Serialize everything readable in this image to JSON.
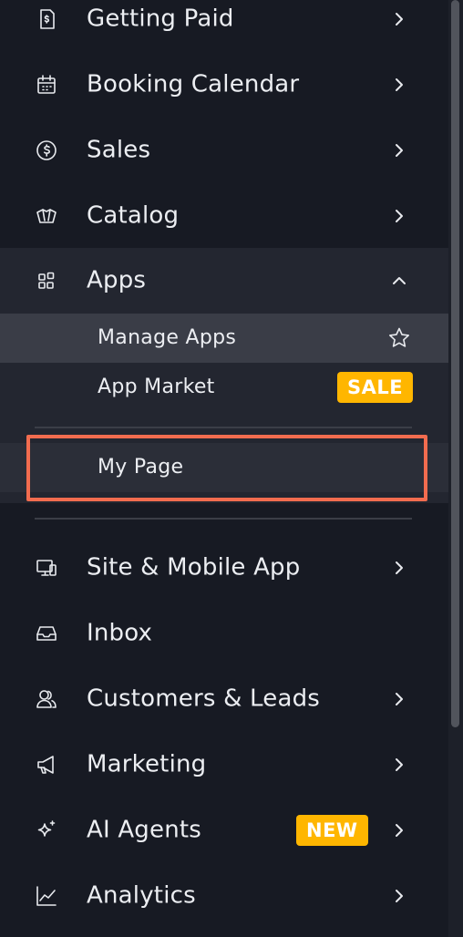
{
  "nav": {
    "getting_paid": {
      "label": "Getting Paid",
      "icon": "receipt-dollar-icon"
    },
    "booking_calendar": {
      "label": "Booking Calendar",
      "icon": "calendar-icon"
    },
    "sales": {
      "label": "Sales",
      "icon": "dollar-circle-icon"
    },
    "catalog": {
      "label": "Catalog",
      "icon": "catalog-cards-icon"
    },
    "apps": {
      "label": "Apps",
      "icon": "apps-grid-icon",
      "expanded": true,
      "children": [
        {
          "label": "Manage Apps",
          "selected": true
        },
        {
          "label": "App Market",
          "badge": "SALE"
        }
      ]
    },
    "my_page": {
      "label": "My Page",
      "highlighted": true
    },
    "site_mobile_app": {
      "label": "Site & Mobile App",
      "icon": "devices-icon"
    },
    "inbox": {
      "label": "Inbox",
      "icon": "inbox-tray-icon"
    },
    "customers_leads": {
      "label": "Customers & Leads",
      "icon": "people-icon"
    },
    "marketing": {
      "label": "Marketing",
      "icon": "megaphone-icon"
    },
    "ai_agents": {
      "label": "AI Agents",
      "icon": "sparkle-icon",
      "badge": "NEW"
    },
    "analytics": {
      "label": "Analytics",
      "icon": "line-chart-icon"
    }
  },
  "colors": {
    "background": "#171a23",
    "expanded_group": "#232630",
    "selected_item": "#3a3d47",
    "badge": "#ffb600",
    "highlight_border": "#f26c4f"
  }
}
